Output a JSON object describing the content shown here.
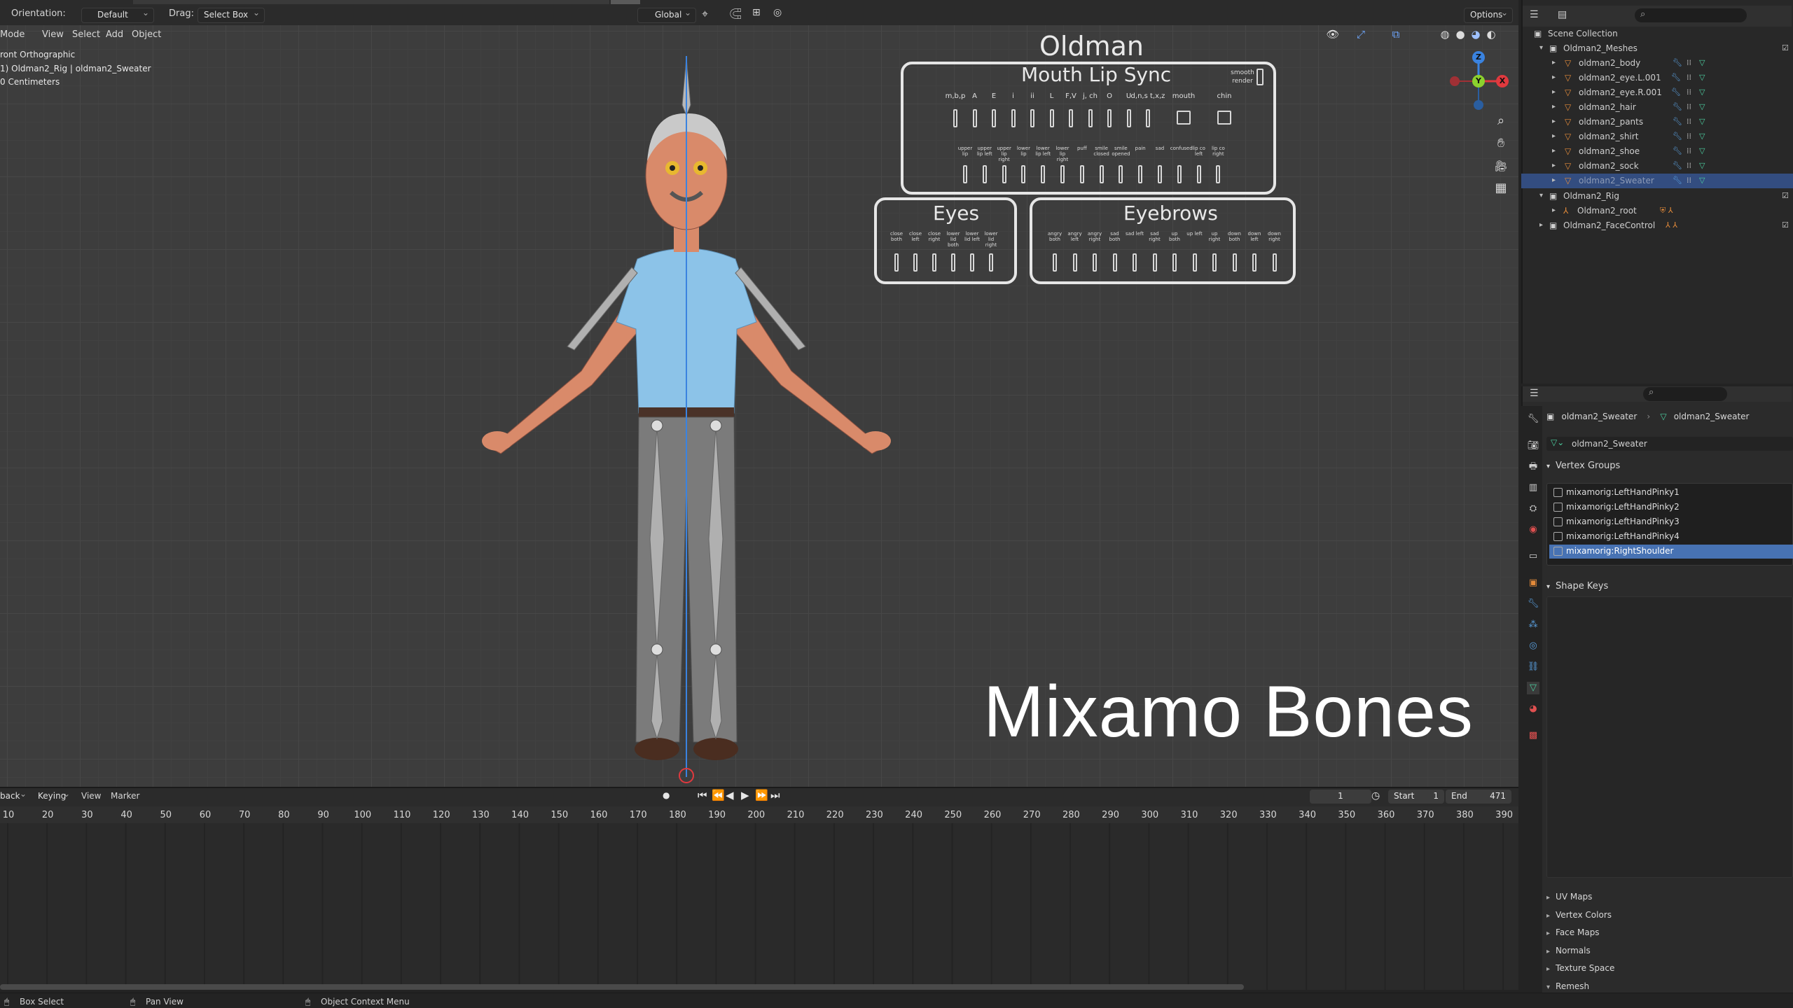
{
  "topbar": {
    "orientation_label": "Orientation:",
    "orientation_value": "Default",
    "drag_label": "Drag:",
    "drag_value": "Select Box",
    "transform_space": "Global",
    "options_label": "Options"
  },
  "viewport_header": {
    "mode": "Mode",
    "menus": [
      "View",
      "Select",
      "Add",
      "Object"
    ]
  },
  "viewport_info": {
    "line1": "ront Orthographic",
    "line2": "1) Oldman2_Rig | oldman2_Sweater",
    "line3": "0 Centimeters"
  },
  "overlay": {
    "character_title": "Oldman",
    "mouth_title": "Mouth Lip Sync",
    "smooth_label": "smooth",
    "render_label": "render",
    "mouth_labels": [
      "m,b,p",
      "A",
      "E",
      "i",
      "ii",
      "L",
      "F,V",
      "j, ch",
      "O",
      "U",
      "d,n,s t,x,z",
      "mouth",
      "chin"
    ],
    "mouth_row2_labels": [
      "upper lip",
      "upper lip left",
      "upper lip right",
      "lower lip",
      "lower lip left",
      "lower lip right",
      "puff",
      "smile closed",
      "smile opened",
      "pain",
      "sad",
      "confused",
      "lip co left",
      "lip co right"
    ],
    "eyes_title": "Eyes",
    "eyes_labels": [
      "close both",
      "close left",
      "close right",
      "lower lid both",
      "lower lid left",
      "lower lid right"
    ],
    "eyebrows_title": "Eyebrows",
    "eyebrows_labels": [
      "angry both",
      "angry left",
      "angry right",
      "sad both",
      "sad left",
      "sad right",
      "up both",
      "up left",
      "up right",
      "down both",
      "down left",
      "down right"
    ],
    "caption": "Mixamo Bones"
  },
  "gizmo": {
    "x": "X",
    "y": "Y",
    "z": "Z"
  },
  "outliner": {
    "scene_collection": "Scene Collection",
    "meshes_collection": "Oldman2_Meshes",
    "mesh_items": [
      "oldman2_body",
      "oldman2_eye.L.001",
      "oldman2_eye.R.001",
      "oldman2_hair",
      "oldman2_pants",
      "oldman2_shirt",
      "oldman2_shoe",
      "oldman2_sock",
      "oldman2_Sweater"
    ],
    "rig_collection": "Oldman2_Rig",
    "rig_item": "Oldman2_root",
    "face_collection": "Oldman2_FaceControl"
  },
  "properties": {
    "breadcrumb_object": "oldman2_Sweater",
    "breadcrumb_data": "oldman2_Sweater",
    "data_name": "oldman2_Sweater",
    "vertex_groups_title": "Vertex Groups",
    "vertex_groups": [
      "mixamorig:LeftHandPinky1",
      "mixamorig:LeftHandPinky2",
      "mixamorig:LeftHandPinky3",
      "mixamorig:LeftHandPinky4",
      "mixamorig:RightShoulder"
    ],
    "shape_keys_title": "Shape Keys",
    "collapsed_sections": [
      "UV Maps",
      "Vertex Colors",
      "Face Maps",
      "Normals",
      "Texture Space",
      "Remesh"
    ]
  },
  "timeline": {
    "playback": "back",
    "keying": "Keying",
    "view": "View",
    "marker": "Marker",
    "current_frame": "1",
    "start_label": "Start",
    "start_value": "1",
    "end_label": "End",
    "end_value": "471",
    "ticks": [
      "10",
      "20",
      "30",
      "40",
      "50",
      "60",
      "70",
      "80",
      "90",
      "100",
      "110",
      "120",
      "130",
      "140",
      "150",
      "160",
      "170",
      "180",
      "190",
      "200",
      "210",
      "220",
      "230",
      "240",
      "250",
      "260",
      "270",
      "280",
      "290",
      "300",
      "310",
      "320",
      "330",
      "340",
      "350",
      "360",
      "370",
      "380",
      "390"
    ]
  },
  "statusbar": {
    "left": "Box Select",
    "middle": "Pan View",
    "right": "Object Context Menu"
  },
  "colors": {
    "selection": "#4772b3",
    "mesh_icon": "#e48b3a",
    "modifier": "#5aa0e0",
    "vertex_group": "#4ccfa0",
    "gizmo_x": "#e0393e",
    "gizmo_y": "#8cd12d",
    "gizmo_z": "#3a83e0"
  }
}
